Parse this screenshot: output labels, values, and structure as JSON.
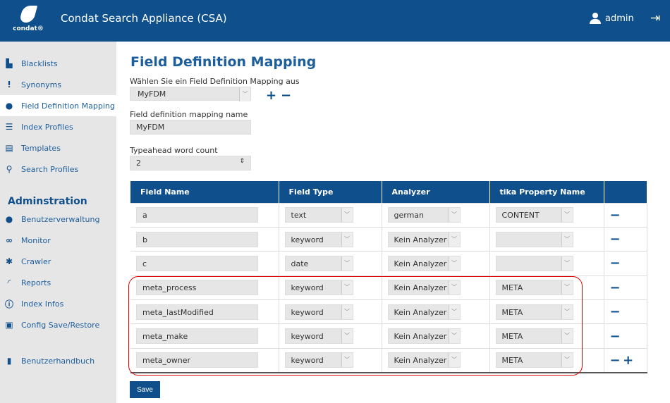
{
  "header": {
    "logo_text": "condat®",
    "title": "Condat Search Appliance (CSA)",
    "user": "admin"
  },
  "sidebar": {
    "items": [
      {
        "label": "Blacklists",
        "icon": "file-x-icon"
      },
      {
        "label": "Synonyms",
        "icon": "people-icon"
      },
      {
        "label": "Field Definition Mapping",
        "icon": "map-marker-icon",
        "active": true
      },
      {
        "label": "Index Profiles",
        "icon": "list-icon"
      },
      {
        "label": "Templates",
        "icon": "template-icon"
      },
      {
        "label": "Search Profiles",
        "icon": "search-icon"
      }
    ],
    "admin_title": "Adminstration",
    "admin_items": [
      {
        "label": "Benutzerverwaltung",
        "icon": "user-icon"
      },
      {
        "label": "Monitor",
        "icon": "binoculars-icon"
      },
      {
        "label": "Crawler",
        "icon": "bug-icon"
      },
      {
        "label": "Reports",
        "icon": "gauge-icon"
      },
      {
        "label": "Index Infos",
        "icon": "info-icon"
      },
      {
        "label": "Config Save/Restore",
        "icon": "save-icon"
      }
    ],
    "manual": {
      "label": "Benutzerhandbuch",
      "icon": "book-icon"
    }
  },
  "page": {
    "title": "Field Definition Mapping",
    "select_label": "Wählen Sie ein Field Definition Mapping aus",
    "select_value": "MyFDM",
    "name_label": "Field definition mapping name",
    "name_value": "MyFDM",
    "typeahead_label": "Typeahead word count",
    "typeahead_value": "2",
    "save_label": "Save"
  },
  "table": {
    "headers": [
      "Field Name",
      "Field Type",
      "Analyzer",
      "tika Property Name"
    ],
    "rows": [
      {
        "name": "a",
        "type": "text",
        "analyzer": "german",
        "tika": "CONTENT"
      },
      {
        "name": "b",
        "type": "keyword",
        "analyzer": "Kein Analyzer",
        "tika": ""
      },
      {
        "name": "c",
        "type": "date",
        "analyzer": "Kein Analyzer",
        "tika": ""
      },
      {
        "name": "meta_process",
        "type": "keyword",
        "analyzer": "Kein Analyzer",
        "tika": "META"
      },
      {
        "name": "meta_lastModified",
        "type": "keyword",
        "analyzer": "Kein Analyzer",
        "tika": "META"
      },
      {
        "name": "meta_make",
        "type": "keyword",
        "analyzer": "Kein Analyzer",
        "tika": "META"
      },
      {
        "name": "meta_owner",
        "type": "keyword",
        "analyzer": "Kein Analyzer",
        "tika": "META"
      }
    ]
  },
  "colors": {
    "brand": "#0f4f8c",
    "highlight": "#dd0000"
  }
}
